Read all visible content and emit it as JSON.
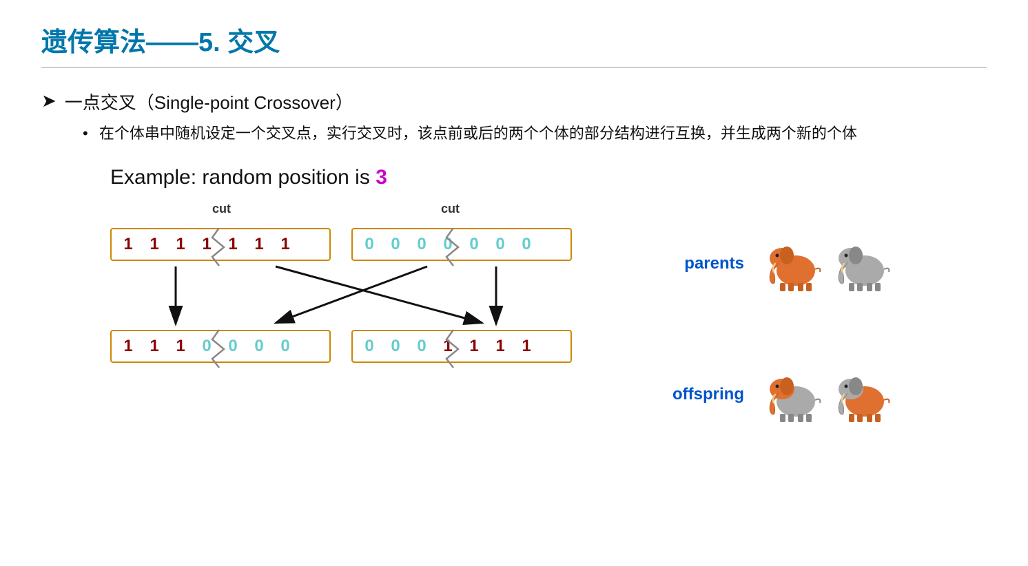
{
  "title": "遗传算法——5. 交叉",
  "bullet_main": "一点交叉（Single-point Crossover）",
  "bullet_sub": "在个体串中随机设定一个交叉点，实行交叉时，该点前或后的两个个体的部分结构进行互换，并生成两个新的个体",
  "example_prefix": "Example: random position is ",
  "example_number": "3",
  "cut_label": "cut",
  "parent1_genes": [
    "1",
    "1",
    "1",
    "1",
    "1",
    "1",
    "1"
  ],
  "parent2_genes": [
    "0",
    "0",
    "0",
    "0",
    "0",
    "0",
    "0"
  ],
  "offspring1_genes_dark": [
    "1",
    "1",
    "1"
  ],
  "offspring1_genes_light": [
    "0",
    "0",
    "0",
    "0"
  ],
  "offspring2_genes_light": [
    "0",
    "0",
    "0"
  ],
  "offspring2_genes_dark": [
    "1",
    "1",
    "1",
    "1"
  ],
  "parents_label": "parents",
  "offspring_label": "offspring",
  "colors": {
    "title": "#0077aa",
    "highlight_number": "#cc00cc",
    "dark_red": "#8b0000",
    "teal": "#66cccc",
    "panel_label": "#0055cc",
    "box_border": "#cc8800"
  }
}
